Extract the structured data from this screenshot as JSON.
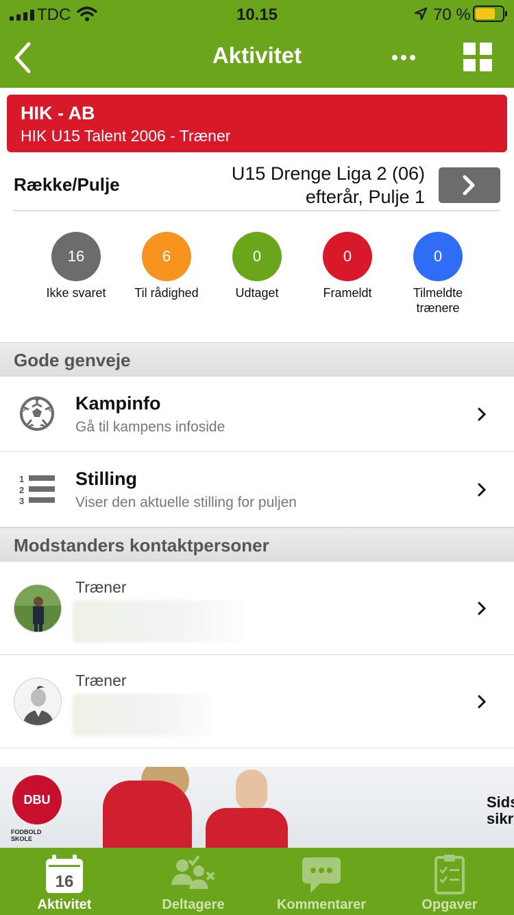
{
  "status": {
    "carrier": "TDC",
    "time": "10.15",
    "battery": "70 %"
  },
  "header": {
    "title": "Aktivitet"
  },
  "match": {
    "title": "HIK - AB",
    "subtitle": "HIK U15 Talent 2006 - Træner"
  },
  "pulje": {
    "label": "Række/Pulje",
    "value_line1": "U15 Drenge Liga 2 (06)",
    "value_line2": "efterår, Pulje 1"
  },
  "stats": [
    {
      "count": "16",
      "label": "Ikke svaret",
      "color": "#6c6c6c"
    },
    {
      "count": "6",
      "label": "Til rådighed",
      "color": "#f7931e"
    },
    {
      "count": "0",
      "label": "Udtaget",
      "color": "#6aa51c"
    },
    {
      "count": "0",
      "label": "Frameldt",
      "color": "#d7192a"
    },
    {
      "count": "0",
      "label": "Tilmeldte trænere",
      "color": "#2f6df6"
    }
  ],
  "shortcuts": {
    "section_title": "Gode genveje",
    "items": [
      {
        "title": "Kampinfo",
        "subtitle": "Gå til kampens infoside",
        "icon": "soccer-ball-icon"
      },
      {
        "title": "Stilling",
        "subtitle": "Viser den aktuelle stilling for puljen",
        "icon": "ranked-list-icon"
      }
    ]
  },
  "contacts": {
    "section_title": "Modstanders kontaktpersoner",
    "items": [
      {
        "role": "Træner"
      },
      {
        "role": "Træner"
      }
    ]
  },
  "banner": {
    "logo": "DBU",
    "logo_caption_line1": "FODBOLD",
    "logo_caption_line2": "SKOLE",
    "side_text_line1": "Sids",
    "side_text_line2": "sikr"
  },
  "tabs": [
    {
      "label": "Aktivitet",
      "badge": "16",
      "active": true
    },
    {
      "label": "Deltagere",
      "active": false
    },
    {
      "label": "Kommentarer",
      "active": false
    },
    {
      "label": "Opgaver",
      "active": false
    }
  ]
}
